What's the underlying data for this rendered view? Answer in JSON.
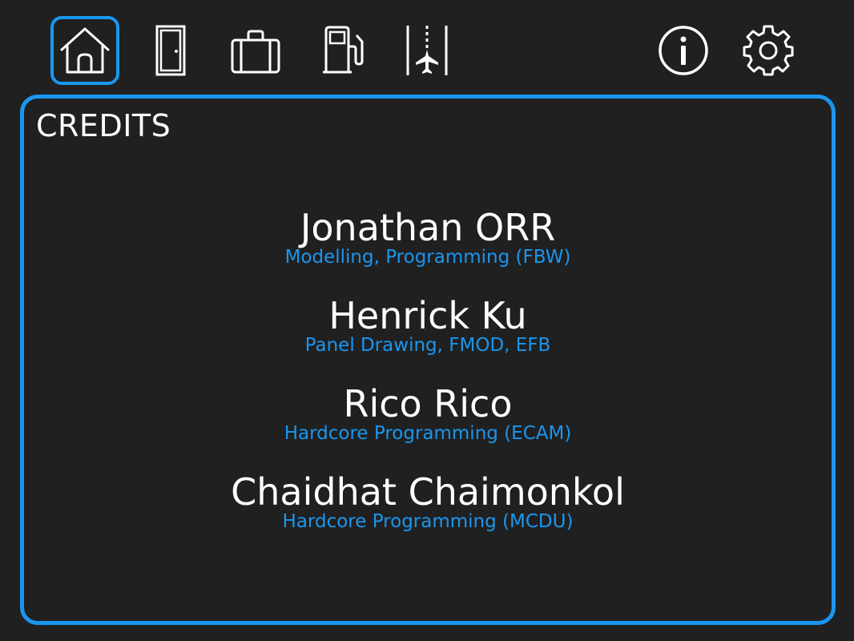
{
  "nav": {
    "items": [
      {
        "icon": "home-icon",
        "label": "Home",
        "active": true
      },
      {
        "icon": "door-icon",
        "label": "Doors",
        "active": false
      },
      {
        "icon": "luggage-icon",
        "label": "Ground",
        "active": false
      },
      {
        "icon": "fuel-pump-icon",
        "label": "Fuel",
        "active": false
      },
      {
        "icon": "runway-plane-icon",
        "label": "Runway",
        "active": false
      },
      {
        "icon": "info-icon",
        "label": "Info",
        "active": false
      },
      {
        "icon": "gear-icon",
        "label": "Settings",
        "active": false
      }
    ]
  },
  "colors": {
    "background": "#202020",
    "accent": "#1a96f0",
    "text": "#ffffff"
  },
  "panel": {
    "title": "CREDITS",
    "credits": [
      {
        "name": "Jonathan ORR",
        "role": "Modelling, Programming (FBW)"
      },
      {
        "name": "Henrick Ku",
        "role": "Panel Drawing, FMOD, EFB"
      },
      {
        "name": "Rico Rico",
        "role": "Hardcore Programming (ECAM)"
      },
      {
        "name": "Chaidhat Chaimonkol",
        "role": "Hardcore Programming (MCDU)"
      }
    ]
  }
}
